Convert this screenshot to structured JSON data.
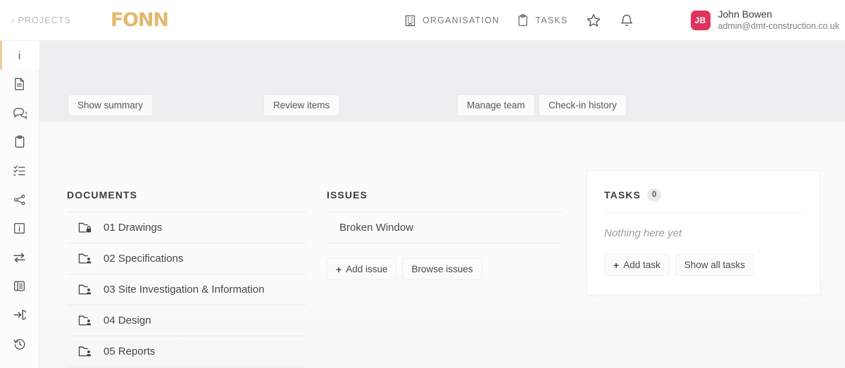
{
  "header": {
    "back_label": "PROJECTS",
    "back_chevron": "‹",
    "brand": "FONN",
    "nav": [
      {
        "label": "ORGANISATION",
        "icon": "building-icon"
      },
      {
        "label": "TASKS",
        "icon": "clipboard-icon"
      }
    ],
    "favorite_icon": "star-icon",
    "notification_icon": "bell-icon",
    "user": {
      "initials": "JB",
      "name": "John Bowen",
      "email": "admin@dmt-construction.co.uk"
    }
  },
  "sidebar": {
    "items": [
      {
        "icon": "info-icon",
        "active": true
      },
      {
        "icon": "document-icon",
        "active": false
      },
      {
        "icon": "chat-icon",
        "active": false
      },
      {
        "icon": "clipboard-icon",
        "active": false
      },
      {
        "icon": "checklist-icon",
        "active": false
      },
      {
        "icon": "share-nodes-icon",
        "active": false
      },
      {
        "icon": "info-box-icon",
        "active": false
      },
      {
        "icon": "transfer-arrows-icon",
        "active": false
      },
      {
        "icon": "table-list-icon",
        "active": false
      },
      {
        "icon": "sign-in-icon",
        "active": false
      },
      {
        "icon": "history-icon",
        "active": false
      }
    ]
  },
  "toolbar": {
    "show_summary": "Show summary",
    "review_items": "Review items",
    "manage_team": "Manage team",
    "checkin_history": "Check-in history"
  },
  "documents": {
    "title": "DOCUMENTS",
    "rows": [
      {
        "label": "01 Drawings",
        "icon": "folder-lock-icon"
      },
      {
        "label": "02 Specifications",
        "icon": "folder-user-icon"
      },
      {
        "label": "03 Site Investigation & Information",
        "icon": "folder-user-icon"
      },
      {
        "label": "04 Design",
        "icon": "folder-user-icon"
      },
      {
        "label": "05 Reports",
        "icon": "folder-user-icon"
      }
    ]
  },
  "issues": {
    "title": "ISSUES",
    "rows": [
      {
        "label": "Broken Window"
      }
    ],
    "add_label": "Add issue",
    "add_plus": "+",
    "browse_label": "Browse issues"
  },
  "tasks": {
    "title": "TASKS",
    "count": "0",
    "empty_text": "Nothing here yet",
    "add_label": "Add task",
    "add_plus": "+",
    "show_all_label": "Show all tasks"
  },
  "colors": {
    "brand": "#e3b86b",
    "avatar": "#e0325c",
    "active_accent": "#e8cf9a",
    "toolbar_band": "#eeeef0"
  }
}
